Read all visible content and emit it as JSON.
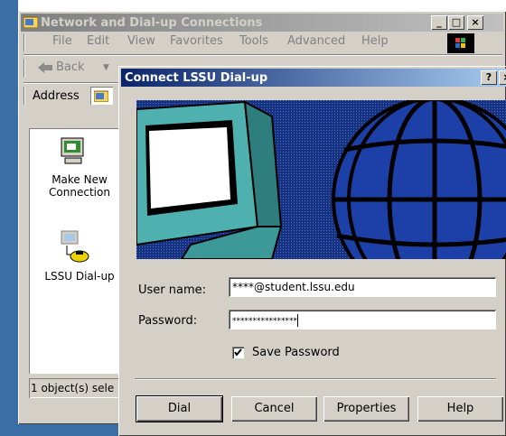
{
  "explorer": {
    "title": "Network and Dial-up Connections",
    "menu": [
      "File",
      "Edit",
      "View",
      "Favorites",
      "Tools",
      "Advanced",
      "Help"
    ],
    "back_label": "Back",
    "address_label": "Address",
    "icons": [
      {
        "label_line1": "Make New",
        "label_line2": "Connection"
      },
      {
        "label_line1": "LSSU Dial-up",
        "label_line2": ""
      }
    ],
    "status_text": "1 object(s) sele"
  },
  "dialog": {
    "title": "Connect LSSU Dial-up",
    "help_glyph": "?",
    "close_glyph": "×",
    "username_label": "User name:",
    "username_value": "****@student.lssu.edu",
    "password_label": "Password:",
    "password_value": "****************",
    "save_password_label": "Save Password",
    "save_password_checked": true,
    "buttons": {
      "dial": "Dial",
      "cancel": "Cancel",
      "properties": "Properties",
      "help": "Help"
    }
  },
  "window_controls": {
    "minimize": "_",
    "maximize": "□",
    "close": "×"
  },
  "colors": {
    "title_active": "#0a246a",
    "desktop": "#3a6ea5",
    "banner": "#1c3a8f"
  }
}
